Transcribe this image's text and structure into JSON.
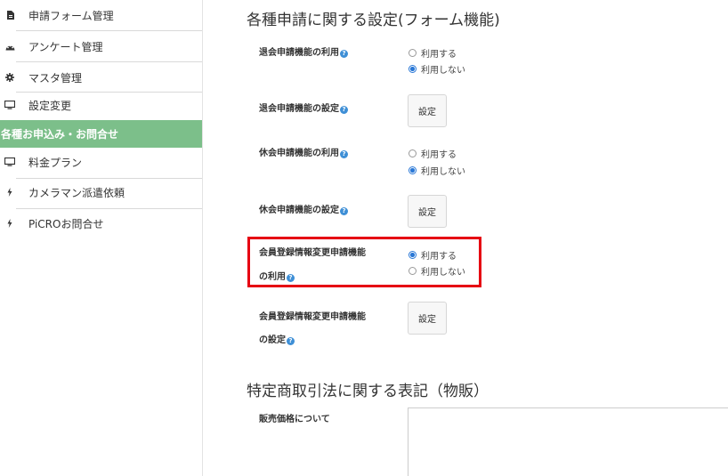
{
  "sidebar": {
    "items_top": [
      {
        "label": "申請フォーム管理",
        "icon": "file-icon"
      },
      {
        "label": "アンケート管理",
        "icon": "dashboard-icon"
      },
      {
        "label": "マスタ管理",
        "icon": "gear-icon"
      },
      {
        "label": "設定変更",
        "icon": "desktop-icon"
      }
    ],
    "section_label": "各種お申込み・お問合せ",
    "items_bottom": [
      {
        "label": "料金プラン",
        "icon": "desktop-icon"
      },
      {
        "label": "カメラマン派遣依頼",
        "icon": "bolt-icon"
      },
      {
        "label": "PiCROお問合せ",
        "icon": "bolt-icon"
      }
    ]
  },
  "main": {
    "section1_title": "各種申請に関する設定(フォーム機能)",
    "rows": [
      {
        "label": "退会申請機能の利用",
        "type": "radio",
        "options": [
          "利用する",
          "利用しない"
        ],
        "selected": "利用しない"
      },
      {
        "label": "退会申請機能の設定",
        "type": "button",
        "button_label": "設定"
      },
      {
        "label": "休会申請機能の利用",
        "type": "radio",
        "options": [
          "利用する",
          "利用しない"
        ],
        "selected": "利用しない"
      },
      {
        "label": "休会申請機能の設定",
        "type": "button",
        "button_label": "設定"
      },
      {
        "label_line1": "会員登録情報変更申請機能",
        "label_line2": "の利用",
        "type": "radio",
        "options": [
          "利用する",
          "利用しない"
        ],
        "selected": "利用する"
      },
      {
        "label_line1": "会員登録情報変更申請機能",
        "label_line2": "の設定",
        "type": "button",
        "button_label": "設定"
      }
    ],
    "section2_title": "特定商取引法に関する表記（物販）",
    "sales_price_label": "販売価格について",
    "sales_price_value": ""
  },
  "colors": {
    "sidebar_section_bg": "#7cbf8a",
    "highlight_border": "#e60012",
    "help_icon": "#3e8fd6",
    "radio_selected": "#2a78d6"
  }
}
